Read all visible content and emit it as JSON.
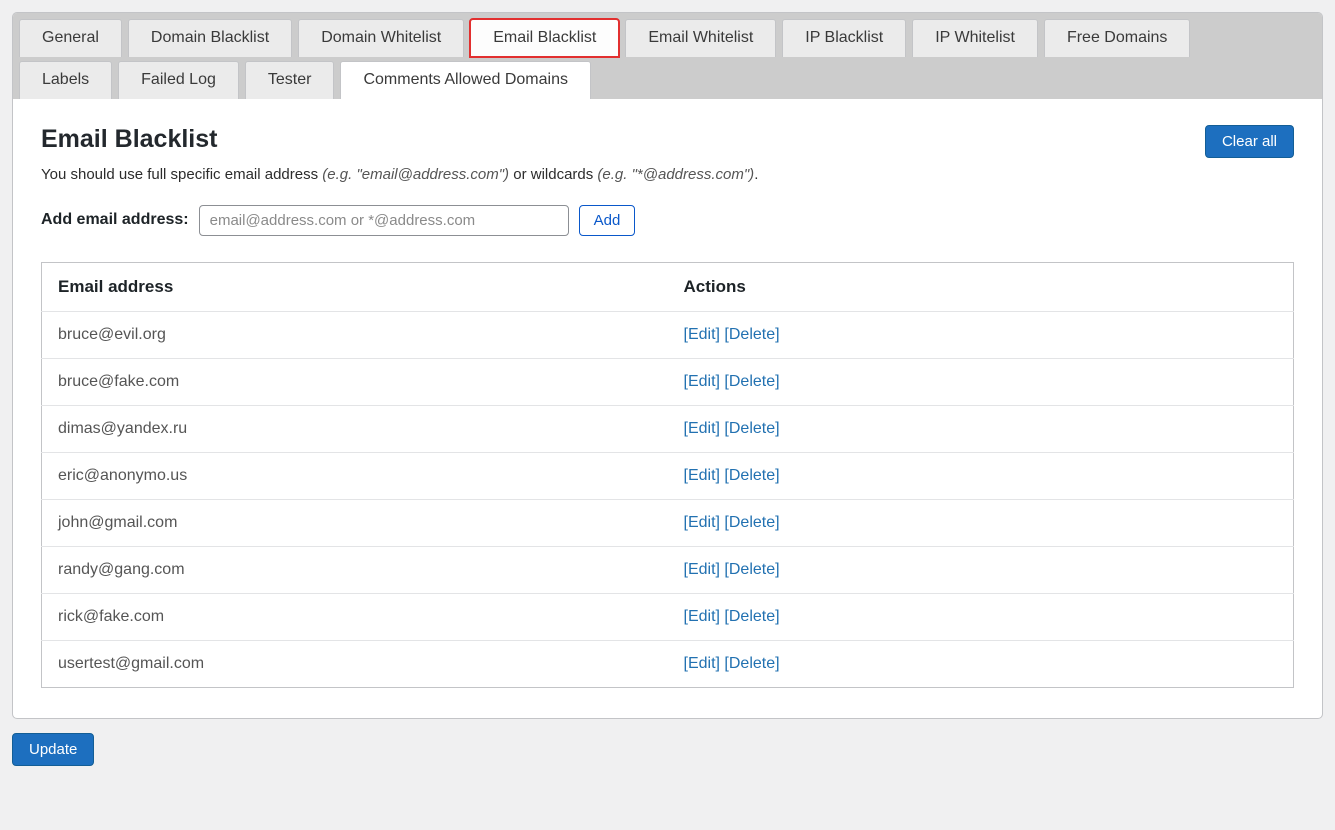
{
  "tabs_row1": [
    {
      "id": "general",
      "label": "General"
    },
    {
      "id": "domain-blacklist",
      "label": "Domain Blacklist"
    },
    {
      "id": "domain-whitelist",
      "label": "Domain Whitelist"
    },
    {
      "id": "email-blacklist",
      "label": "Email Blacklist",
      "highlight": true
    },
    {
      "id": "email-whitelist",
      "label": "Email Whitelist"
    },
    {
      "id": "ip-blacklist",
      "label": "IP Blacklist"
    },
    {
      "id": "ip-whitelist",
      "label": "IP Whitelist"
    },
    {
      "id": "free-domains",
      "label": "Free Domains"
    }
  ],
  "tabs_row2": [
    {
      "id": "labels",
      "label": "Labels"
    },
    {
      "id": "failed-log",
      "label": "Failed Log"
    },
    {
      "id": "tester",
      "label": "Tester"
    },
    {
      "id": "comments-allowed-domains",
      "label": "Comments Allowed Domains",
      "active": true
    }
  ],
  "page": {
    "title": "Email Blacklist",
    "clear_all_label": "Clear all",
    "desc_lead": "You should use full specific email address ",
    "desc_eg1": "(e.g. \"email@address.com\")",
    "desc_mid": " or wildcards ",
    "desc_eg2": "(e.g. \"*@address.com\")",
    "desc_end": "."
  },
  "add_form": {
    "label": "Add email address:",
    "placeholder": "email@address.com or *@address.com",
    "submit_label": "Add"
  },
  "table": {
    "col_email": "Email address",
    "col_actions": "Actions",
    "edit_label": "[Edit]",
    "delete_label": "[Delete]",
    "rows": [
      {
        "email": "bruce@evil.org"
      },
      {
        "email": "bruce@fake.com"
      },
      {
        "email": "dimas@yandex.ru"
      },
      {
        "email": "eric@anonymo.us"
      },
      {
        "email": "john@gmail.com"
      },
      {
        "email": "randy@gang.com"
      },
      {
        "email": "rick@fake.com"
      },
      {
        "email": "usertest@gmail.com"
      }
    ]
  },
  "footer": {
    "update_label": "Update"
  }
}
